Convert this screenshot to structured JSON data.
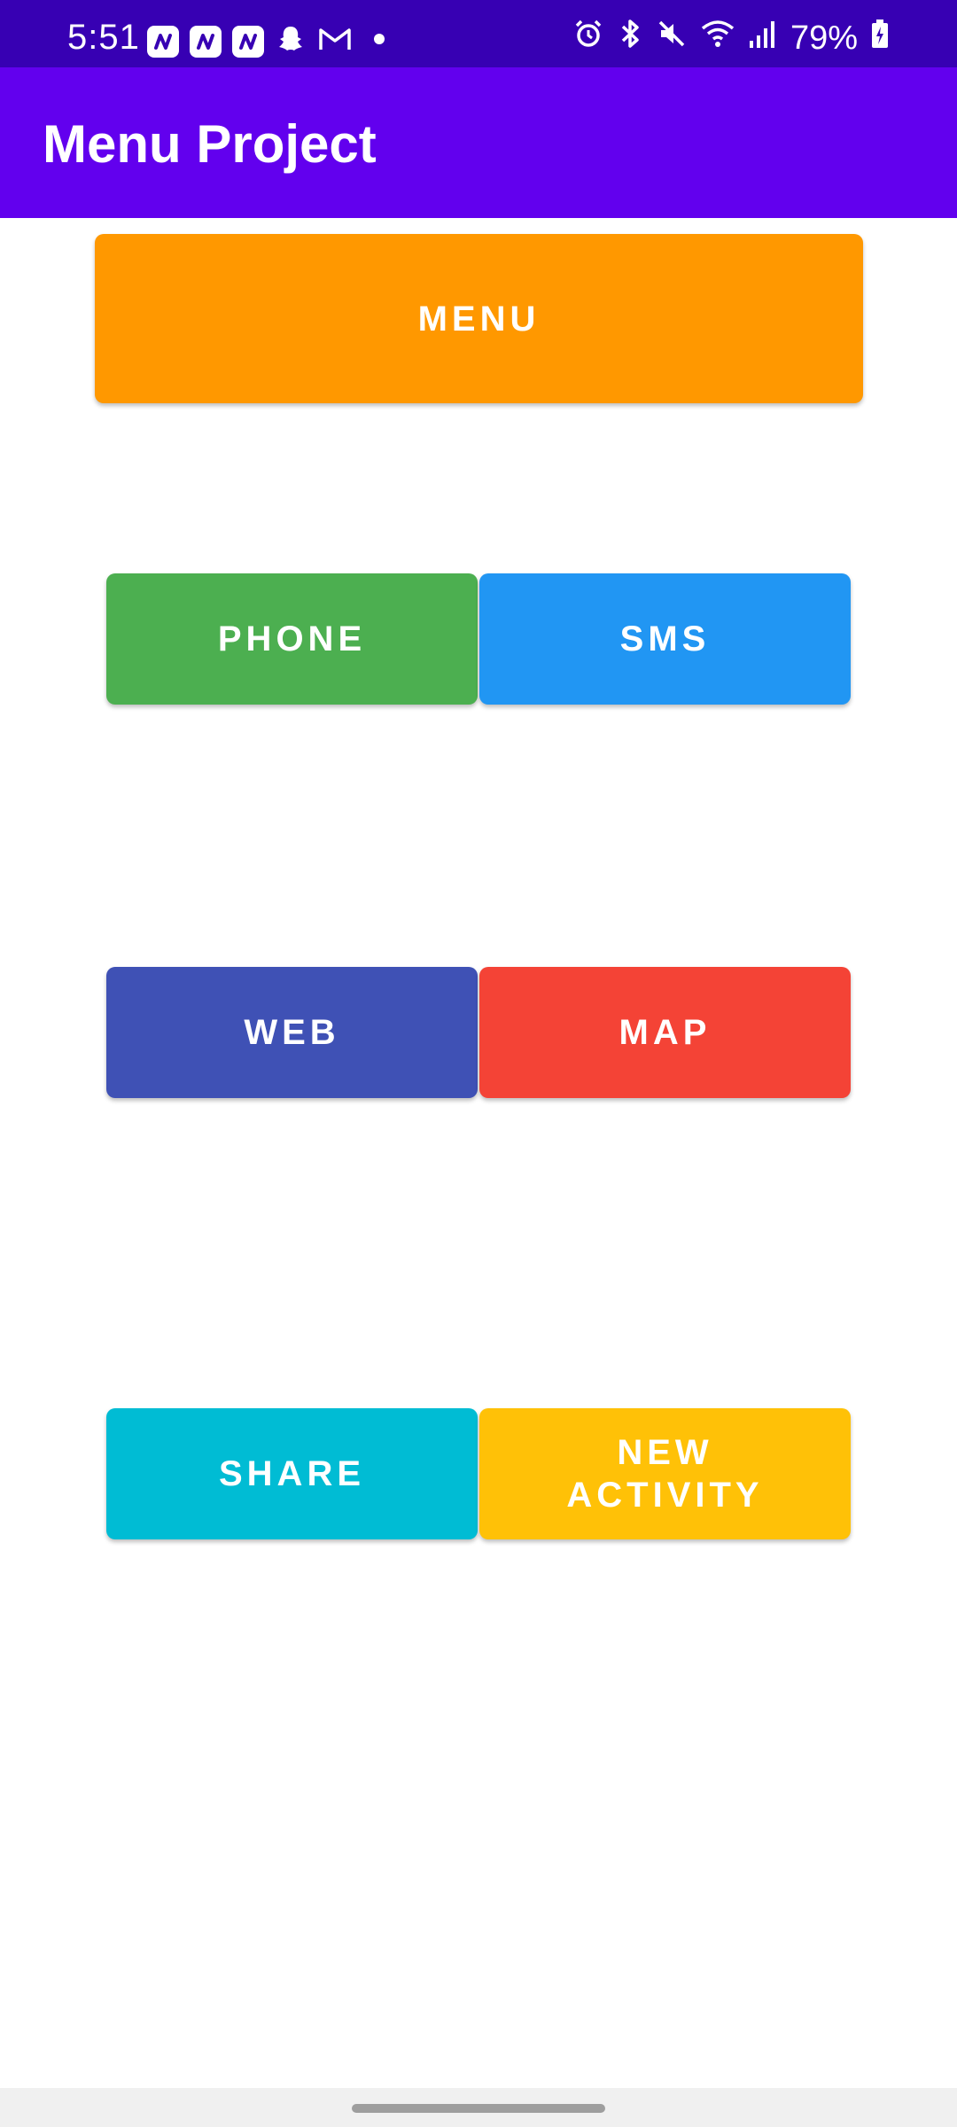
{
  "status_bar": {
    "time": "5:51",
    "battery": "79%",
    "background": "#3700b3",
    "notification_icons": [
      "app-notification-icon",
      "app-notification-icon",
      "app-notification-icon",
      "snapchat-icon",
      "gmail-icon",
      "dot-icon"
    ],
    "system_icons": [
      "alarm-icon",
      "bluetooth-icon",
      "mute-icon",
      "wifi-icon",
      "signal-icon",
      "battery-charging-icon"
    ]
  },
  "app_bar": {
    "title": "Menu Project",
    "background": "#6200ee"
  },
  "buttons": {
    "menu": {
      "label": "MENU",
      "color": "#ff9800"
    },
    "phone": {
      "label": "PHONE",
      "color": "#4caf50"
    },
    "sms": {
      "label": "SMS",
      "color": "#2196f3"
    },
    "web": {
      "label": "WEB",
      "color": "#3f51b5"
    },
    "map": {
      "label": "MAP",
      "color": "#f44336"
    },
    "share": {
      "label": "SHARE",
      "color": "#00bcd4"
    },
    "new_activity": {
      "label": "NEW\nACTIVITY",
      "color": "#ffc107"
    }
  }
}
